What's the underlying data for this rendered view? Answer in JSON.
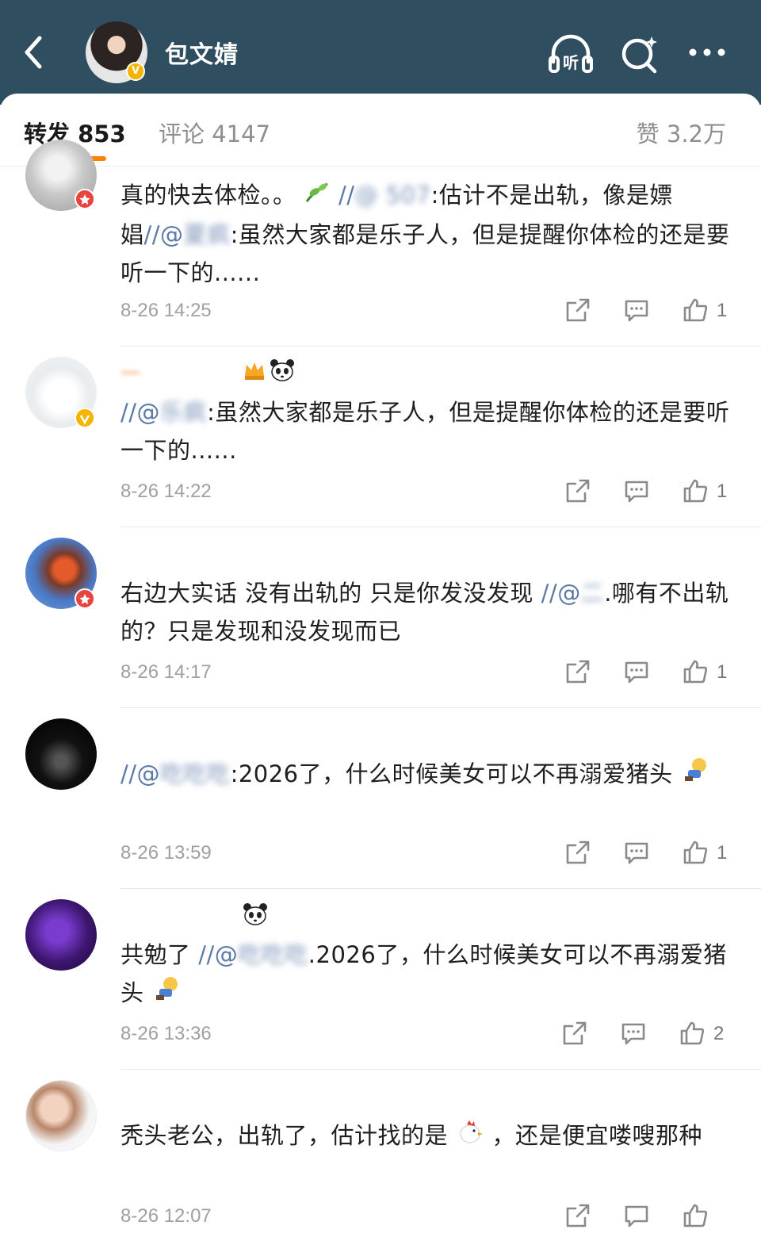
{
  "header": {
    "title": "包文婧",
    "listen_label": "听",
    "bg": "#2f4f60"
  },
  "tabs": {
    "repost": "转发 853",
    "comments": "评论 4147",
    "likes": "赞 3.2万"
  },
  "comments": [
    {
      "name": "",
      "text_a": "真的快去体检。。",
      "text_b": "//",
      "text_c": "@ 507",
      "text_d": ":估计不是出轨，像是嫖娼",
      "text_e": "//@",
      "text_f": "夏疯",
      "text_g": ":虽然大家都是乐子人，但是提醒你体检的还是要听一下的......",
      "time": "8-26 14:25",
      "likes": "1",
      "badge": "red"
    },
    {
      "name": "一",
      "text_a": "//@",
      "text_b": "乐疯",
      "text_c": ":虽然大家都是乐子人，但是提醒你体检的还是要听一下的......",
      "time": "8-26 14:22",
      "likes": "1",
      "badge": "gold"
    },
    {
      "name": "",
      "text_a": "右边大实话 没有出轨的 只是你发没发现",
      "text_b": "//@",
      "text_c": "二",
      "text_d": ".哪有不出轨的？只是发现和没发现而已",
      "time": "8-26 14:17",
      "likes": "1",
      "badge": "red"
    },
    {
      "name": "",
      "text_a": "//@",
      "text_b": "吃吃吃",
      "text_c": ":2026了，什么时候美女可以不再溺爱猪头",
      "time": "8-26 13:59",
      "likes": "1"
    },
    {
      "name": "",
      "text_a": "共勉了",
      "text_b": "//@",
      "text_c": "吃吃吃",
      "text_d": ".2026了，什么时候美女可以不再溺爱猪头",
      "time": "8-26 13:36",
      "likes": "2"
    },
    {
      "name": "",
      "text_a": "秃头老公，出轨了，估计找的是",
      "text_b": "，还是便宜喽嗖那种",
      "time": "8-26 12:07",
      "likes": ""
    }
  ]
}
